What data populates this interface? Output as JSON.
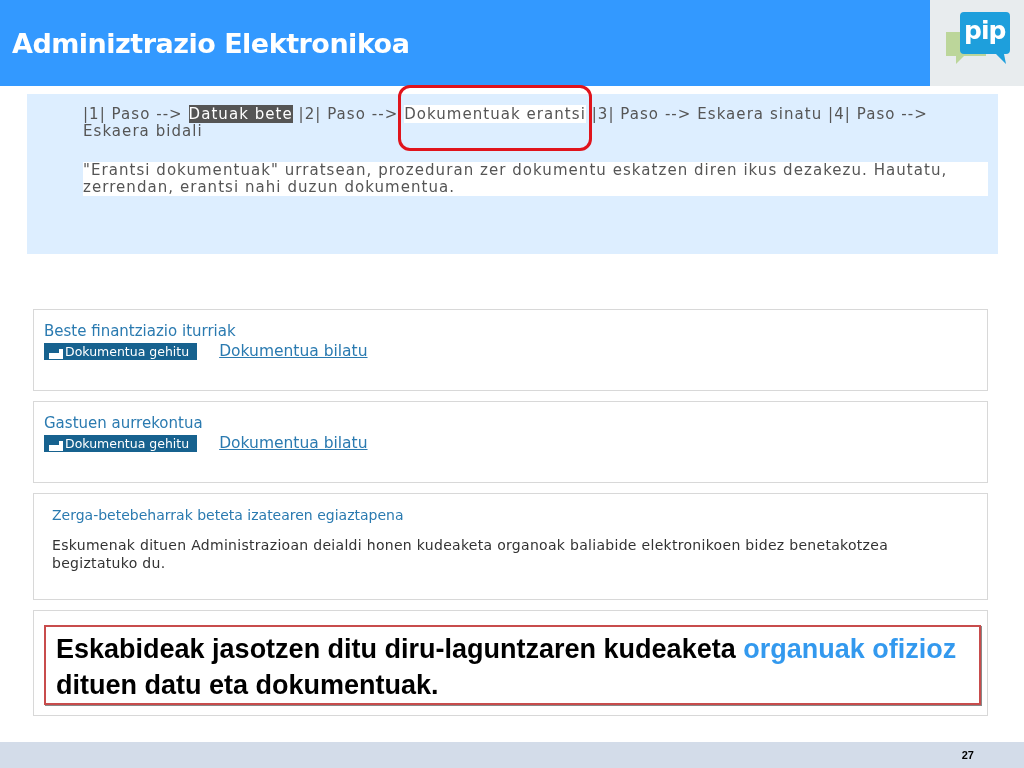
{
  "header": {
    "title": "Adminiztrazio Elektronikoa",
    "logo_text": "pip"
  },
  "intro": {
    "steps": [
      {
        "text": "|1| Paso --> ",
        "kind": "plain",
        "circled": false
      },
      {
        "text": "Datuak bete",
        "kind": "current",
        "circled": false
      },
      {
        "text": " |2| Paso --> ",
        "kind": "plain",
        "circled": false
      },
      {
        "text": "Dokumentuak erantsi",
        "kind": "next",
        "circled": true
      },
      {
        "text": " |3| Paso --> Eskaera sinatu |4| Paso --> Eskaera bidali",
        "kind": "plain",
        "circled": false
      }
    ],
    "instruction": "\"Erantsi dokumentuak\" urratsean, prozeduran zer dokumentu eskatzen diren ikus dezakezu. Hautatu, zerrendan, erantsi nahi duzun dokumentua."
  },
  "documents": [
    {
      "kind": "upload",
      "title": "Beste finantziazio iturriak",
      "add_button": "Dokumentua gehitu",
      "search_link": "Dokumentua bilatu"
    },
    {
      "kind": "upload",
      "title": "Gastuen aurrekontua",
      "add_button": "Dokumentua gehitu",
      "search_link": "Dokumentua bilatu"
    },
    {
      "kind": "info",
      "title": "Zerga-betebeharrak beteta izatearen egiaztapena",
      "text": "Eskumenak dituen Administrazioan deialdi honen kudeaketa organoak baliabide elektronikoen bidez benetakotzea begiztatuko du."
    }
  ],
  "callout": {
    "segments": [
      {
        "text": "Eskabideak jasotzen ditu diru-laguntzaren kudeaketa ",
        "highlight": false
      },
      {
        "text": "organuak ofizioz",
        "highlight": true
      },
      {
        "text": " dituen datu eta dokumentuak.",
        "highlight": false
      }
    ]
  },
  "footer": {
    "page_number": "27"
  }
}
